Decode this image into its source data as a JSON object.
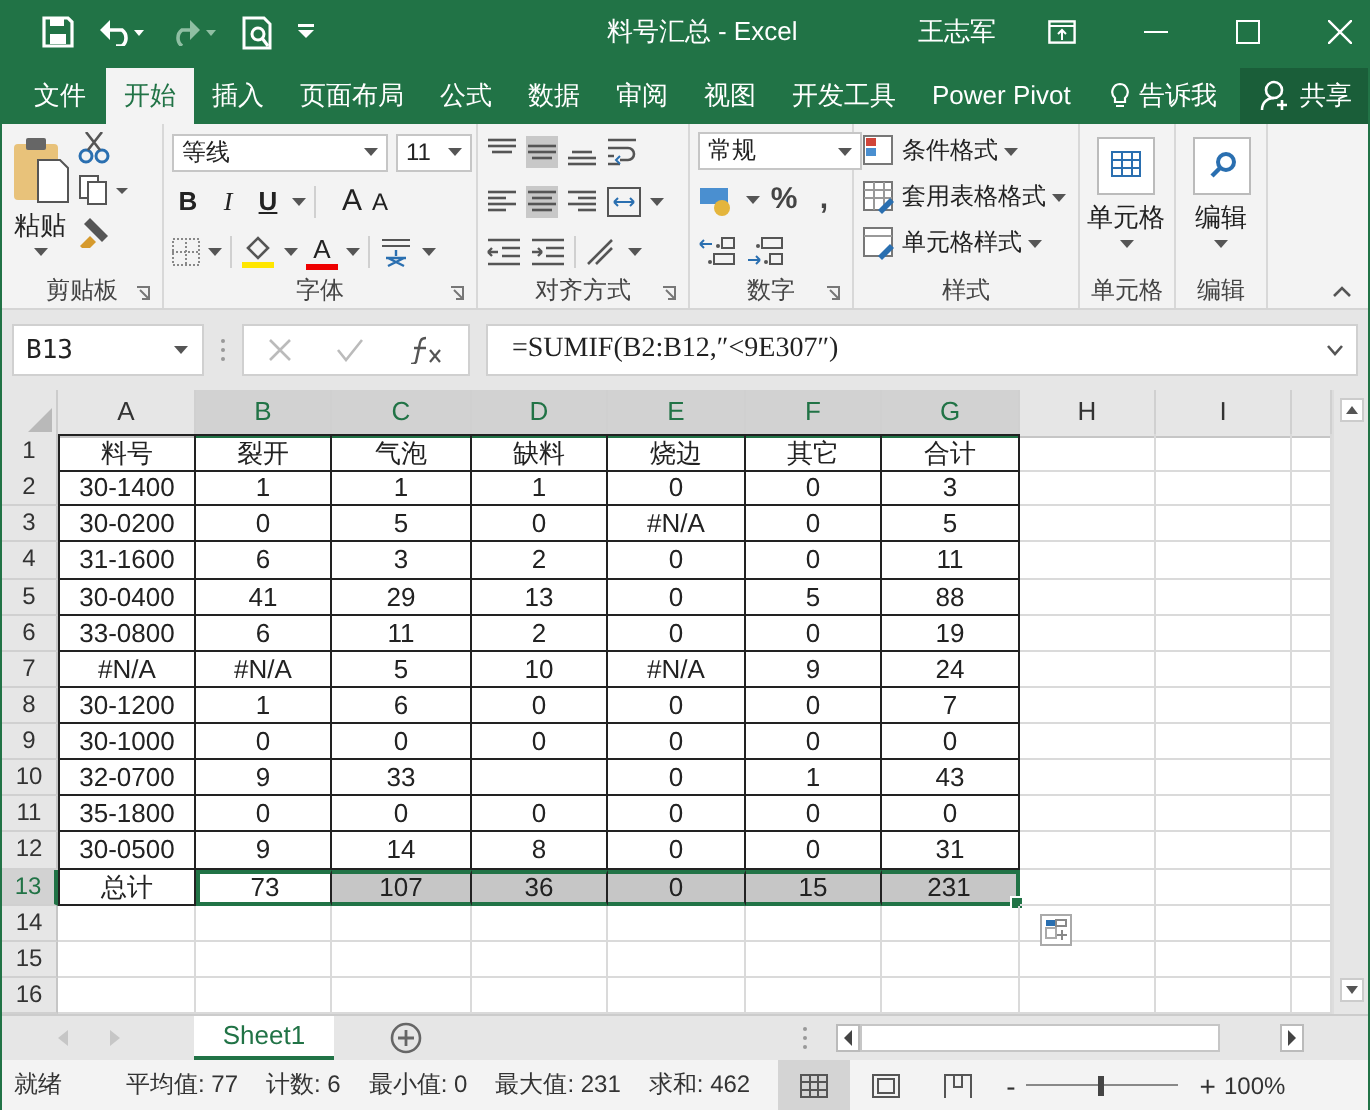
{
  "window": {
    "title": "料号汇总 - Excel",
    "user": "王志军"
  },
  "tabs": [
    {
      "label": "文件",
      "kind": "file",
      "selected": false
    },
    {
      "label": "开始",
      "kind": "tab",
      "selected": true
    },
    {
      "label": "插入",
      "kind": "tab",
      "selected": false
    },
    {
      "label": "页面布局",
      "kind": "tab",
      "selected": false
    },
    {
      "label": "公式",
      "kind": "tab",
      "selected": false
    },
    {
      "label": "数据",
      "kind": "tab",
      "selected": false
    },
    {
      "label": "审阅",
      "kind": "tab",
      "selected": false
    },
    {
      "label": "视图",
      "kind": "tab",
      "selected": false
    },
    {
      "label": "开发工具",
      "kind": "tab",
      "selected": false
    },
    {
      "label": "Power Pivot",
      "kind": "tab",
      "selected": false
    },
    {
      "label": "告诉我",
      "kind": "tell",
      "selected": false
    }
  ],
  "share": "共享",
  "ribbon": [
    {
      "kind": "clipboard",
      "label": "剪贴板",
      "paste": "粘贴"
    },
    {
      "kind": "font",
      "label": "字体",
      "font_name": "等线",
      "font_size": "11",
      "bold": "B",
      "italic": "I",
      "underline": "U",
      "grow": "A",
      "shrink": "A",
      "font_color": "A"
    },
    {
      "kind": "alignment",
      "label": "对齐方式",
      "vertical": [
        {
          "kind": "top",
          "selected": false
        },
        {
          "kind": "middle",
          "selected": true
        },
        {
          "kind": "bottom",
          "selected": false
        }
      ],
      "horizontal": [
        {
          "kind": "left",
          "selected": false
        },
        {
          "kind": "center",
          "selected": true
        },
        {
          "kind": "right",
          "selected": false
        }
      ]
    },
    {
      "kind": "number",
      "label": "数字",
      "format": "常规",
      "percent": "%",
      "comma": ","
    },
    {
      "kind": "styles",
      "label": "样式",
      "items": [
        "条件格式",
        "套用表格格式",
        "单元格样式"
      ]
    },
    {
      "kind": "cells",
      "label": "单元格",
      "button": "单元格"
    },
    {
      "kind": "editing",
      "label": "编辑",
      "button": "编辑"
    }
  ],
  "formula_bar": {
    "name_box": "B13",
    "formula": "=SUMIF(B2:B12,″<9E307″)"
  },
  "sheet": {
    "columns": [
      {
        "label": "A",
        "selected": false
      },
      {
        "label": "B",
        "selected": true
      },
      {
        "label": "C",
        "selected": true
      },
      {
        "label": "D",
        "selected": true
      },
      {
        "label": "E",
        "selected": true
      },
      {
        "label": "F",
        "selected": true
      },
      {
        "label": "G",
        "selected": true
      },
      {
        "label": "H",
        "selected": false
      },
      {
        "label": "I",
        "selected": false
      }
    ],
    "rows": [
      {
        "header": "1",
        "selected": false,
        "cells": [
          "料号",
          "裂开",
          "气泡",
          "缺料",
          "烧边",
          "其它",
          "合计"
        ]
      },
      {
        "header": "2",
        "selected": false,
        "cells": [
          "30-1400",
          "1",
          "1",
          "1",
          "0",
          "0",
          "3"
        ]
      },
      {
        "header": "3",
        "selected": false,
        "cells": [
          "30-0200",
          "0",
          "5",
          "0",
          "#N/A",
          "0",
          "5"
        ]
      },
      {
        "header": "4",
        "selected": false,
        "cells": [
          "31-1600",
          "6",
          "3",
          "2",
          "0",
          "0",
          "11"
        ]
      },
      {
        "header": "5",
        "selected": false,
        "cells": [
          "30-0400",
          "41",
          "29",
          "13",
          "0",
          "5",
          "88"
        ]
      },
      {
        "header": "6",
        "selected": false,
        "cells": [
          "33-0800",
          "6",
          "11",
          "2",
          "0",
          "0",
          "19"
        ]
      },
      {
        "header": "7",
        "selected": false,
        "cells": [
          "#N/A",
          "#N/A",
          "5",
          "10",
          "#N/A",
          "9",
          "24"
        ]
      },
      {
        "header": "8",
        "selected": false,
        "cells": [
          "30-1200",
          "1",
          "6",
          "0",
          "0",
          "0",
          "7"
        ]
      },
      {
        "header": "9",
        "selected": false,
        "cells": [
          "30-1000",
          "0",
          "0",
          "0",
          "0",
          "0",
          "0"
        ]
      },
      {
        "header": "10",
        "selected": false,
        "cells": [
          "32-0700",
          "9",
          "33",
          null,
          "0",
          "1",
          "43"
        ]
      },
      {
        "header": "11",
        "selected": false,
        "cells": [
          "35-1800",
          "0",
          "0",
          "0",
          "0",
          "0",
          "0"
        ]
      },
      {
        "header": "12",
        "selected": false,
        "cells": [
          "30-0500",
          "9",
          "14",
          "8",
          "0",
          "0",
          "31"
        ]
      },
      {
        "header": "13",
        "selected": true,
        "cells": [
          "总计",
          "73",
          "107",
          "36",
          "0",
          "15",
          "231"
        ]
      },
      {
        "header": "14",
        "selected": false
      },
      {
        "header": "15",
        "selected": false
      },
      {
        "header": "16",
        "selected": false
      }
    ]
  },
  "sheet_tabs": [
    {
      "label": "Sheet1",
      "selected": true
    }
  ],
  "status_bar": {
    "ready": "就绪",
    "stats": [
      "平均值: 77",
      "计数: 6",
      "最小值: 0",
      "最大值: 231",
      "求和: 462"
    ],
    "views": [
      {
        "kind": "normal",
        "selected": true
      },
      {
        "kind": "page-layout",
        "selected": false
      },
      {
        "kind": "page-break",
        "selected": false
      }
    ],
    "zoom_minus": "-",
    "zoom_plus": "+",
    "zoom": {
      "level": 0.5
    },
    "zoom_text": "100%"
  }
}
